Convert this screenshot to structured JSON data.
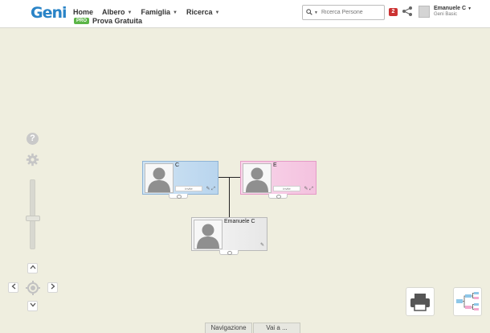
{
  "header": {
    "logo": "Geni",
    "nav": [
      {
        "label": "Home",
        "dropdown": false
      },
      {
        "label": "Albero",
        "dropdown": true
      },
      {
        "label": "Famiglia",
        "dropdown": true
      },
      {
        "label": "Ricerca",
        "dropdown": true
      }
    ],
    "pro_badge": "PRO",
    "pro_link": "Prova Gratuita",
    "search_placeholder": "Ricerca Persone",
    "notification_count": "2",
    "user_name": "Emanuele C",
    "user_plan": "Geni Basic"
  },
  "controls": {
    "help_glyph": "?",
    "zoom_level": 0.5,
    "up": "^",
    "down": "v",
    "left": "<",
    "right": ">"
  },
  "tree": {
    "people": [
      {
        "name": "C",
        "gender": "male",
        "invite_label": "invite"
      },
      {
        "name": "E",
        "gender": "female",
        "invite_label": "invite"
      },
      {
        "name": "Emanuele C",
        "gender": "male",
        "invite_label": ""
      }
    ]
  },
  "bottom_tabs": [
    "Navigazione",
    "Vai a ..."
  ],
  "colors": {
    "canvas": "#efeedf",
    "logo_blue": "#2a84c7",
    "pro_green": "#5bb547",
    "notification_red": "#cc3333",
    "male_card": "#b9d5ee",
    "female_card": "#f4c2df"
  },
  "icons": [
    "search-icon",
    "share-icon",
    "help-icon",
    "gear-icon",
    "center-target-icon",
    "print-icon",
    "tree-view-icon",
    "edit-icon",
    "expand-icon"
  ]
}
